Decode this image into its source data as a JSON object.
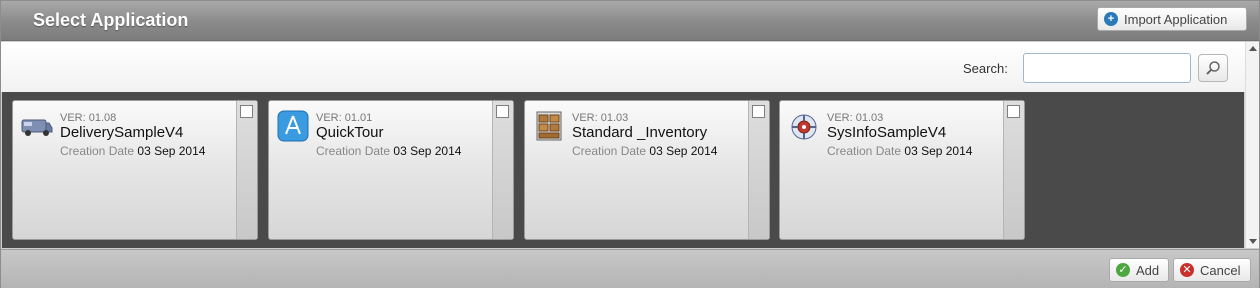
{
  "dialog": {
    "title": "Select Application",
    "import_label": "Import Application"
  },
  "search": {
    "label": "Search:",
    "value": "",
    "placeholder": ""
  },
  "apps": [
    {
      "ver": "VER: 01.08",
      "name": "DeliverySampleV4",
      "date_label": "Creation Date",
      "date": "03 Sep 2014",
      "icon": "delivery-van-icon",
      "checked": false
    },
    {
      "ver": "VER: 01.01",
      "name": "QuickTour",
      "date_label": "Creation Date",
      "date": "03 Sep 2014",
      "icon": "app-store-icon",
      "checked": false
    },
    {
      "ver": "VER: 01.03",
      "name": "Standard _Inventory",
      "date_label": "Creation Date",
      "date": "03 Sep 2014",
      "icon": "inventory-boxes-icon",
      "checked": false
    },
    {
      "ver": "VER: 01.03",
      "name": "SysInfoSampleV4",
      "date_label": "Creation Date",
      "date": "03 Sep 2014",
      "icon": "system-info-icon",
      "checked": false
    }
  ],
  "footer": {
    "add_label": "Add",
    "cancel_label": "Cancel"
  },
  "colors": {
    "titlebar": "#8a8a8a",
    "content_bg": "#4a4a4a",
    "accent_blue": "#2a79b8",
    "add_green": "#4ea640",
    "cancel_red": "#c9302c"
  }
}
